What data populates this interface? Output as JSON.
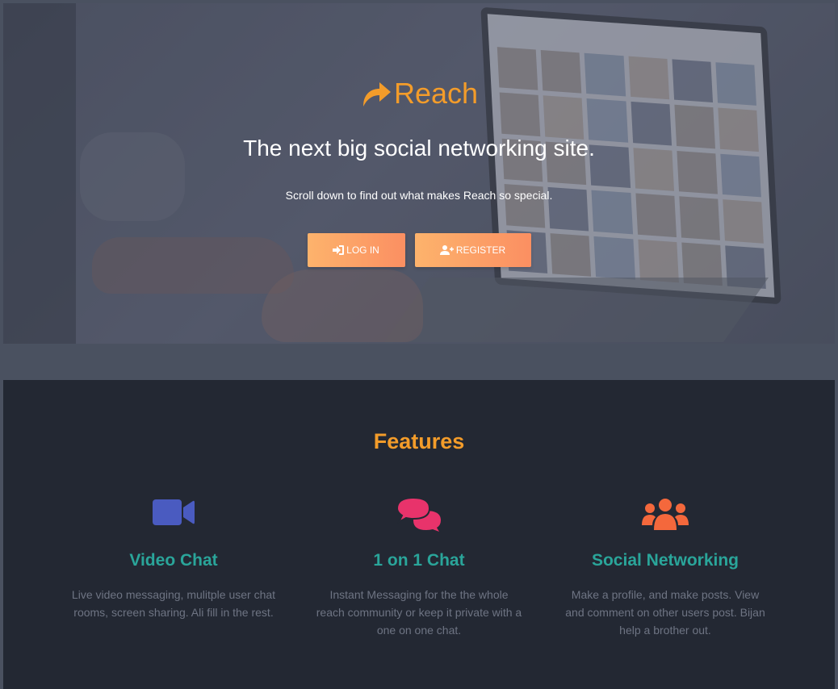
{
  "hero": {
    "brand_name": "Reach",
    "tagline": "The next big social networking site.",
    "subline": "Scroll down to find out what makes Reach so special.",
    "buttons": {
      "login_label": "LOG IN",
      "register_label": "REGISTER"
    }
  },
  "features": {
    "title": "Features",
    "items": [
      {
        "title": "Video Chat",
        "description": "Live video messaging, mulitple user chat rooms, screen sharing. Ali fill in the rest.",
        "icon": "video-camera-icon",
        "color": "#4a5bc0"
      },
      {
        "title": "1 on 1 Chat",
        "description": "Instant Messaging for the the whole reach community or keep it private with a one on one chat.",
        "icon": "chat-bubbles-icon",
        "color": "#e8336b"
      },
      {
        "title": "Social Networking",
        "description": "Make a profile, and make posts. View and comment on other users post. Bijan help a brother out.",
        "icon": "users-group-icon",
        "color": "#f4683c"
      }
    ]
  },
  "colors": {
    "brand": "#f39c2a",
    "feature_title": "#2aa59a",
    "button_gradient_start": "#fdb36c",
    "button_gradient_end": "#fb8f62",
    "features_bg": "#232833"
  }
}
